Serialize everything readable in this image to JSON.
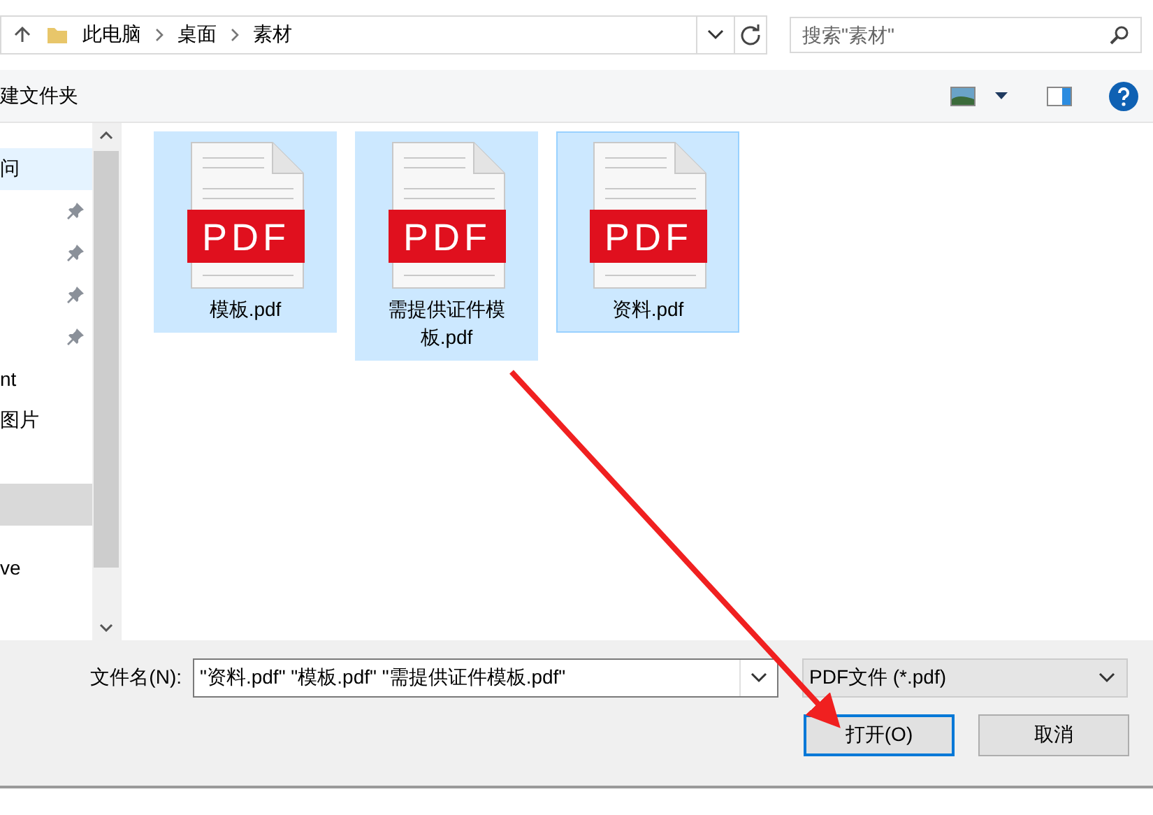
{
  "address_bar": {
    "breadcrumbs": [
      "此电脑",
      "桌面",
      "素材"
    ]
  },
  "search": {
    "placeholder": "搜索\"素材\""
  },
  "toolbar": {
    "new_folder": "建文件夹"
  },
  "sidebar": {
    "items": [
      {
        "label": "问",
        "selected": true,
        "pinned": false,
        "hovered": false
      },
      {
        "selected": false,
        "pinned": true,
        "hovered": false
      },
      {
        "selected": false,
        "pinned": true,
        "hovered": false
      },
      {
        "selected": false,
        "pinned": true,
        "hovered": false
      },
      {
        "selected": false,
        "pinned": true,
        "hovered": false
      },
      {
        "label": "nt",
        "selected": false,
        "pinned": false,
        "hovered": false
      },
      {
        "label": "图片",
        "selected": false,
        "pinned": false,
        "hovered": false
      },
      {
        "selected": false,
        "pinned": false,
        "hovered": true
      },
      {
        "label": "ve",
        "selected": false,
        "pinned": false,
        "hovered": false
      }
    ]
  },
  "files": [
    {
      "name": "模板.pdf",
      "badge": "PDF",
      "selected": true,
      "focused": false
    },
    {
      "name": "需提供证件模板.pdf",
      "badge": "PDF",
      "selected": true,
      "focused": false
    },
    {
      "name": "资料.pdf",
      "badge": "PDF",
      "selected": true,
      "focused": true
    }
  ],
  "footer": {
    "filename_label": "文件名(N):",
    "filename_value": "\"资料.pdf\" \"模板.pdf\" \"需提供证件模板.pdf\"",
    "filter": "PDF文件 (*.pdf)",
    "buttons": [
      {
        "label": "打开(O)",
        "kind": "primary"
      },
      {
        "label": "取消",
        "kind": "normal"
      }
    ]
  }
}
